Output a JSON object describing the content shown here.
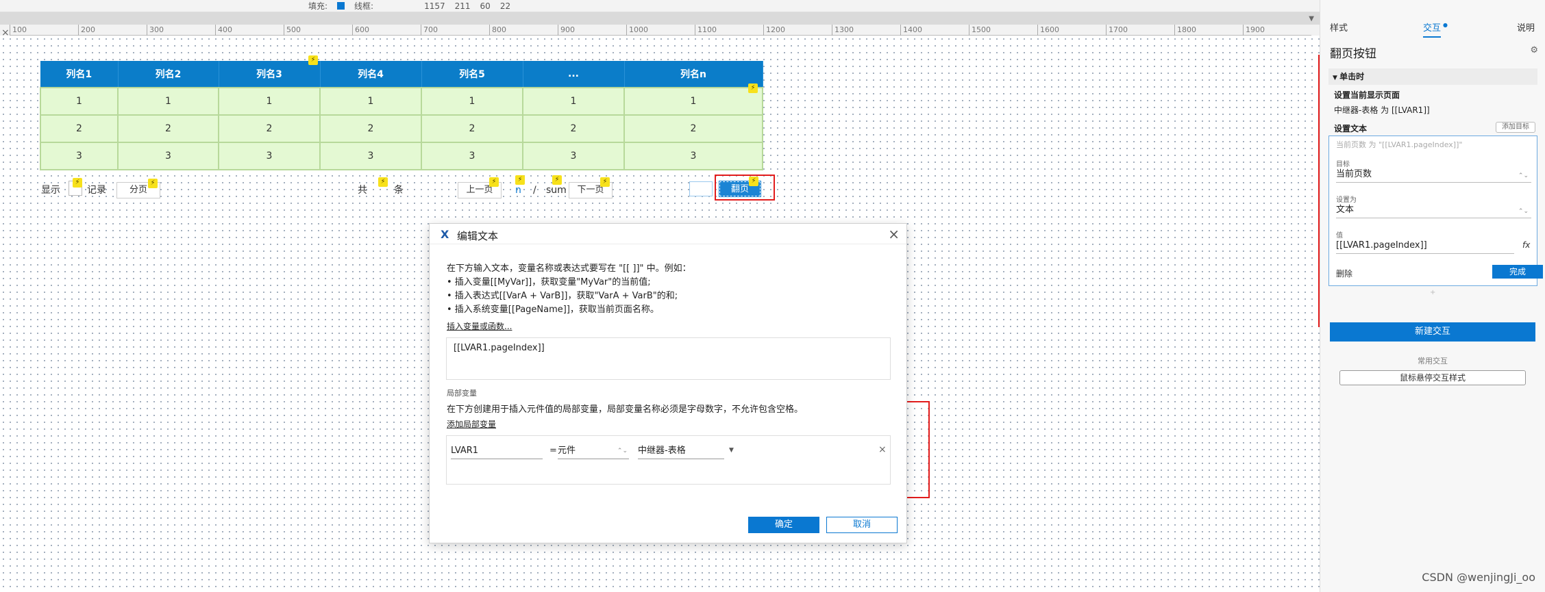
{
  "toolbar": {
    "fill_label": "填充:",
    "line_label": "线框:",
    "x_value": "1157",
    "y_value": "211",
    "w_value": "60",
    "h_value": "22"
  },
  "ruler": {
    "ticks": [
      "100",
      "200",
      "300",
      "400",
      "500",
      "600",
      "700",
      "800",
      "900",
      "1000",
      "1100",
      "1200",
      "1300",
      "1400",
      "1500",
      "1600",
      "1700",
      "1800",
      "1900"
    ]
  },
  "table": {
    "headers": [
      "列名1",
      "列名2",
      "列名3",
      "列名4",
      "列名5",
      "...",
      "列名n"
    ],
    "rows": [
      [
        "1",
        "1",
        "1",
        "1",
        "1",
        "1",
        "1"
      ],
      [
        "2",
        "2",
        "2",
        "2",
        "2",
        "2",
        "2"
      ],
      [
        "3",
        "3",
        "3",
        "3",
        "3",
        "3",
        "3"
      ]
    ]
  },
  "pager": {
    "show_label": "显示",
    "record_label": "记录",
    "paging_button": "分页",
    "total_label": "共",
    "items_label": "条",
    "prev_button": "上一页",
    "current_page": "n",
    "separator": "/",
    "sum_label": "sum",
    "next_button": "下一页",
    "page_button": "翻页"
  },
  "dialog": {
    "title": "编辑文本",
    "intro": "在下方输入文本，变量名称或表达式要写在 \"[[ ]]\" 中。例如：",
    "bullet1": "• 插入变量[[MyVar]]，获取变量\"MyVar\"的当前值;",
    "bullet2": "• 插入表达式[[VarA + VarB]]，获取\"VarA + VarB\"的和;",
    "bullet3": "• 插入系统变量[[PageName]]，获取当前页面名称。",
    "insert_link": "插入变量或函数...",
    "text_value": "[[LVAR1.pageIndex]]",
    "local_vars_label": "局部变量",
    "local_vars_desc": "在下方创建用于插入元件值的局部变量，局部变量名称必须是字母数字，不允许包含空格。",
    "add_local_var": "添加局部变量",
    "var_name": "LVAR1",
    "equals": "=",
    "var_type": "元件",
    "var_target": "中继器-表格",
    "ok_button": "确定",
    "cancel_button": "取消"
  },
  "panel": {
    "tab_style": "样式",
    "tab_interaction": "交互",
    "tab_notes": "说明",
    "title": "翻页按钮",
    "event": "单击时",
    "action1_title": "设置当前显示页面",
    "action1_desc": "中继器-表格 为 [[LVAR1]]",
    "action2_title": "设置文本",
    "add_target": "添加目标",
    "action2_summary": "当前页数 为 \"[[LVAR1.pageIndex]]\"",
    "target_label": "目标",
    "target_value": "当前页数",
    "set_to_label": "设置为",
    "set_to_value": "文本",
    "value_label": "值",
    "value_value": "[[LVAR1.pageIndex]]",
    "fx_label": "fx",
    "delete_label": "删除",
    "done_button": "完成",
    "new_interaction": "新建交互",
    "common_label": "常用交互",
    "hover_button": "鼠标悬停交互样式"
  },
  "watermark": "CSDN @wenjingJi_oo",
  "colors": {
    "header_blue": "#0b7dc9",
    "row_green": "#e4f9d3",
    "accent": "#0a78d1",
    "highlight_red": "#e21b1b"
  }
}
